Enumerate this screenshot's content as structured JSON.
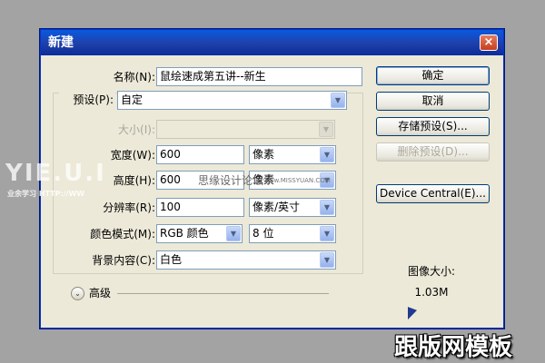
{
  "dialog": {
    "title": "新建",
    "close_glyph": "×"
  },
  "form": {
    "name_label": "名称(N):",
    "name_value": "鼠绘速成第五讲--新生",
    "preset_label": "预设(P):",
    "preset_value": "自定",
    "size_label": "大小(I):",
    "width_label": "宽度(W):",
    "width_value": "600",
    "width_unit": "像素",
    "height_label": "高度(H):",
    "height_value": "600",
    "height_unit": "像素",
    "resolution_label": "分辨率(R):",
    "resolution_value": "100",
    "resolution_unit": "像素/英寸",
    "color_mode_label": "颜色模式(M):",
    "color_mode_value": "RGB 颜色",
    "bit_depth_value": "8 位",
    "background_label": "背景内容(C):",
    "background_value": "白色",
    "advanced_label": "高级"
  },
  "buttons": {
    "ok": "确定",
    "cancel": "取消",
    "save_preset": "存储预设(S)...",
    "delete_preset": "删除预设(D)...",
    "device_central": "Device Central(E)..."
  },
  "image_size": {
    "label": "图像大小:",
    "value": "1.03M"
  },
  "watermarks": {
    "left_logo": "YIE.U.I",
    "left_sub": "业余学习 HTTP://WW",
    "center": "思缘设计论坛",
    "center_url": "www.MISSYUAN.COM",
    "bottom_right": "跟版网模板"
  },
  "colors": {
    "title_bar": "#1f3fa8",
    "dialog_bg": "#ece9d8",
    "page_bg": "#a3a3a3"
  }
}
